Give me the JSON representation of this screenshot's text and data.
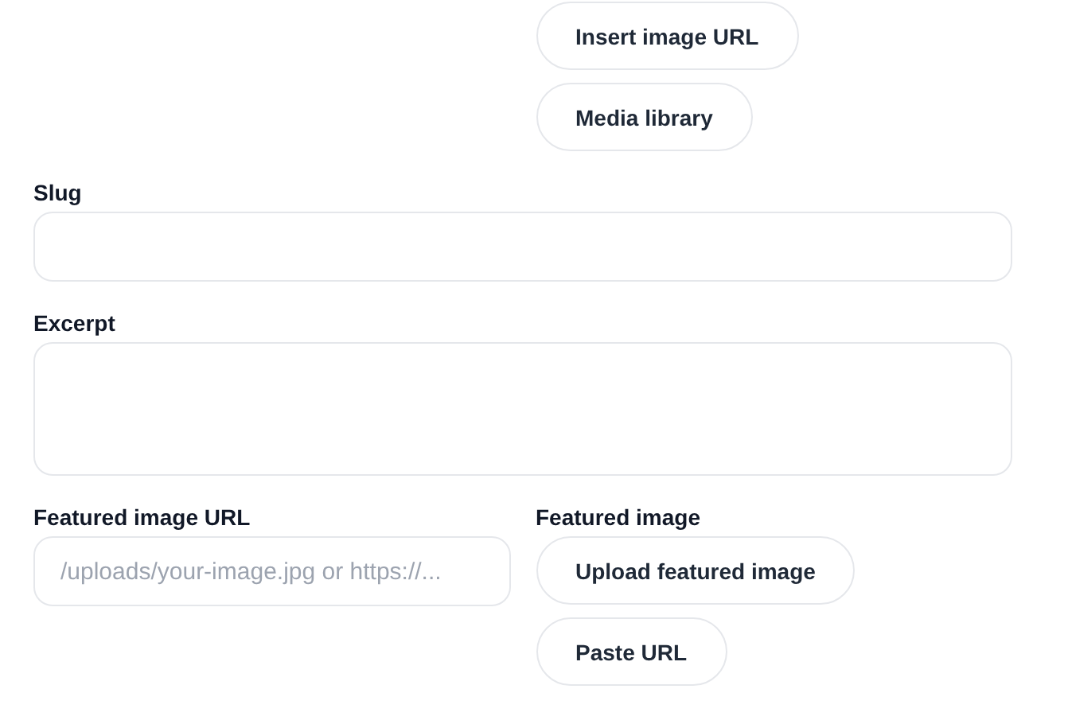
{
  "media_buttons": [
    "Insert image URL",
    "Media library"
  ],
  "slug": {
    "label": "Slug"
  },
  "excerpt": {
    "label": "Excerpt"
  },
  "featured_image_url": {
    "label": "Featured image URL",
    "placeholder": "/uploads/your-image.jpg or https://..."
  },
  "featured_image": {
    "label": "Featured image",
    "buttons": [
      "Upload featured image",
      "Paste URL"
    ]
  }
}
